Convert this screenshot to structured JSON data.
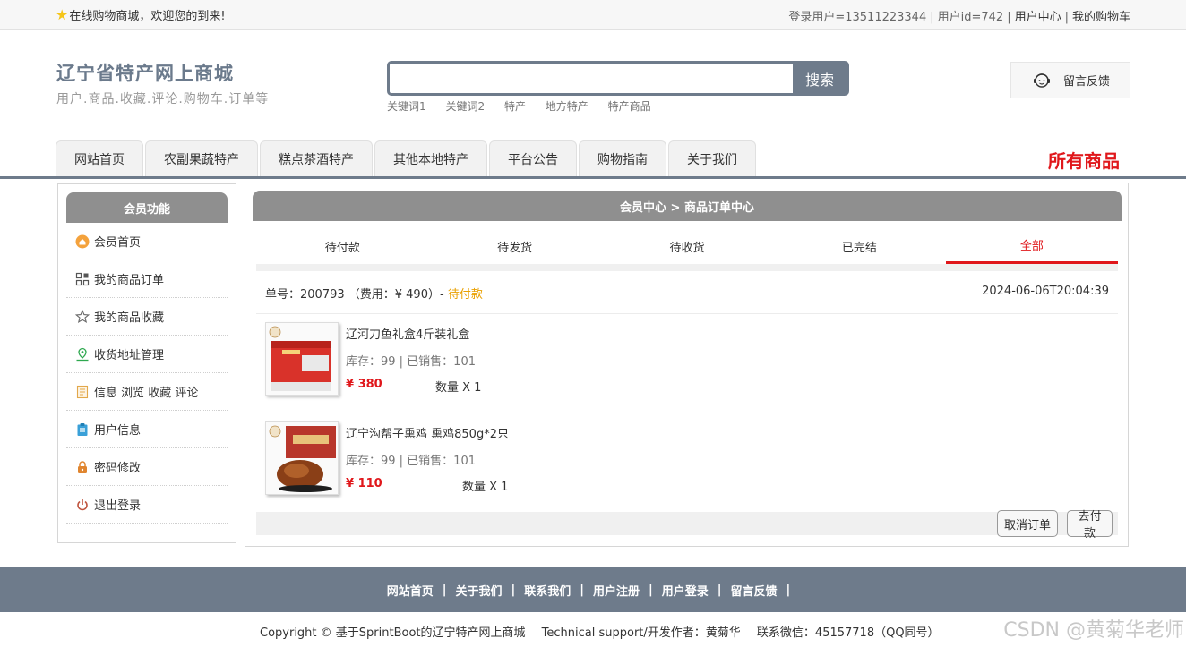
{
  "topbar": {
    "welcome": "在线购物商城，欢迎您的到来!",
    "login_user": "登录用户=13511223344",
    "user_id": "用户id=742",
    "user_center": "用户中心",
    "my_cart": "我的购物车"
  },
  "header": {
    "site_name": "辽宁省特产网上商城",
    "slogan": "用户.商品.收藏.评论.购物车.订单等",
    "search_placeholder": "",
    "search_button": "搜索",
    "keywords": [
      "关键词1",
      "关键词2",
      "特产",
      "地方特产",
      "特产商品"
    ],
    "feedback": "留言反馈"
  },
  "nav": {
    "tabs": [
      "网站首页",
      "农副果蔬特产",
      "糕点茶酒特产",
      "其他本地特产",
      "平台公告",
      "购物指南",
      "关于我们"
    ],
    "all_goods": "所有商品"
  },
  "sidebar": {
    "title": "会员功能",
    "items": [
      {
        "label": "会员首页",
        "icon": "home-icon"
      },
      {
        "label": "我的商品订单",
        "icon": "order-icon"
      },
      {
        "label": "我的商品收藏",
        "icon": "star-icon"
      },
      {
        "label": "收货地址管理",
        "icon": "location-icon"
      },
      {
        "label": "信息 浏览 收藏 评论",
        "icon": "document-icon"
      },
      {
        "label": "用户信息",
        "icon": "clipboard-icon"
      },
      {
        "label": "密码修改",
        "icon": "lock-icon"
      },
      {
        "label": "退出登录",
        "icon": "power-icon"
      }
    ]
  },
  "main": {
    "breadcrumb": "会员中心 > 商品订单中心",
    "status_tabs": [
      "待付款",
      "待发货",
      "待收货",
      "已完结",
      "全部"
    ],
    "active_tab": "全部",
    "order": {
      "number_text": "单号：200793 （费用：¥ 490）-",
      "state": "待付款",
      "time": "2024-06-06T20:04:39",
      "items": [
        {
          "title": "辽河刀鱼礼盒4斤装礼盒",
          "stock": "库存：99 | 已销售：101",
          "price": "¥ 380",
          "qty": "数量 X 1"
        },
        {
          "title": "辽宁沟帮子熏鸡 熏鸡850g*2只",
          "stock": "库存：99 | 已销售：101",
          "price": "¥ 110",
          "qty": "数量 X 1"
        }
      ],
      "cancel_button": "取消订单",
      "pay_button": "去付款"
    }
  },
  "footer": {
    "links": [
      "网站首页",
      "关于我们",
      "联系我们",
      "用户注册",
      "用户登录",
      "留言反馈"
    ],
    "copyright": "Copyright © 基于SprintBoot的辽宁特产网上商城",
    "support": "Technical support/开发作者：黄菊华",
    "contact": "联系微信：45157718（QQ同号）",
    "watermark": "CSDN @黄菊华老师"
  },
  "colors": {
    "accent_gray": "#6e7b8b",
    "red": "#e0171b",
    "pending": "#e9a000"
  }
}
